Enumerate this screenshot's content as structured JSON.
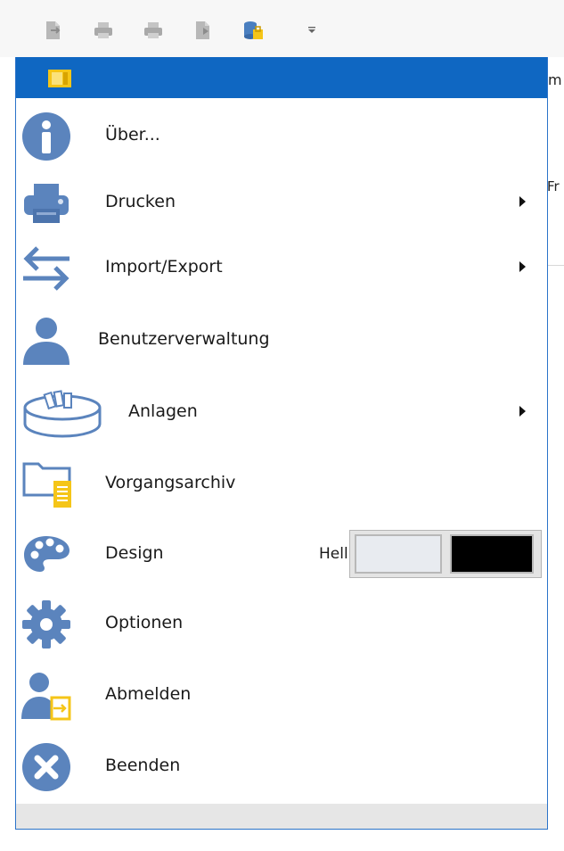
{
  "toolbar": {
    "buttons": [
      {
        "icon": "document-exit-icon"
      },
      {
        "icon": "printer-icon"
      },
      {
        "icon": "printer-icon"
      },
      {
        "icon": "document-arrow-icon"
      },
      {
        "icon": "database-lock-icon"
      }
    ],
    "more_icon": "customize-dropdown-icon"
  },
  "background_peek": {
    "text_a": "m",
    "text_b": "Fr"
  },
  "menu": {
    "header_icon": "app-logo-icon",
    "items": [
      {
        "label": "Über...",
        "icon": "info-icon",
        "submenu": false
      },
      {
        "label": "Drucken",
        "icon": "printer-icon",
        "submenu": true
      },
      {
        "label": "Import/Export",
        "icon": "import-export-icon",
        "submenu": true
      },
      {
        "label": "Benutzerverwaltung",
        "icon": "user-icon",
        "submenu": false
      },
      {
        "label": "Anlagen",
        "icon": "attachment-tray-icon",
        "submenu": true
      },
      {
        "label": "Vorgangsarchiv",
        "icon": "folder-archive-icon",
        "submenu": false
      },
      {
        "label": "Design",
        "icon": "palette-icon",
        "submenu": false
      },
      {
        "label": "Optionen",
        "icon": "gear-icon",
        "submenu": false
      },
      {
        "label": "Abmelden",
        "icon": "logout-icon",
        "submenu": false
      },
      {
        "label": "Beenden",
        "icon": "close-circle-icon",
        "submenu": false
      }
    ],
    "design": {
      "theme_label": "Hell",
      "swatches": [
        {
          "name": "light",
          "color": "#e8ebf0"
        },
        {
          "name": "dark",
          "color": "#000000"
        }
      ]
    }
  },
  "colors": {
    "accent": "#0f67c2",
    "icon_blue": "#5b84bd",
    "icon_yellow": "#f5c518"
  }
}
